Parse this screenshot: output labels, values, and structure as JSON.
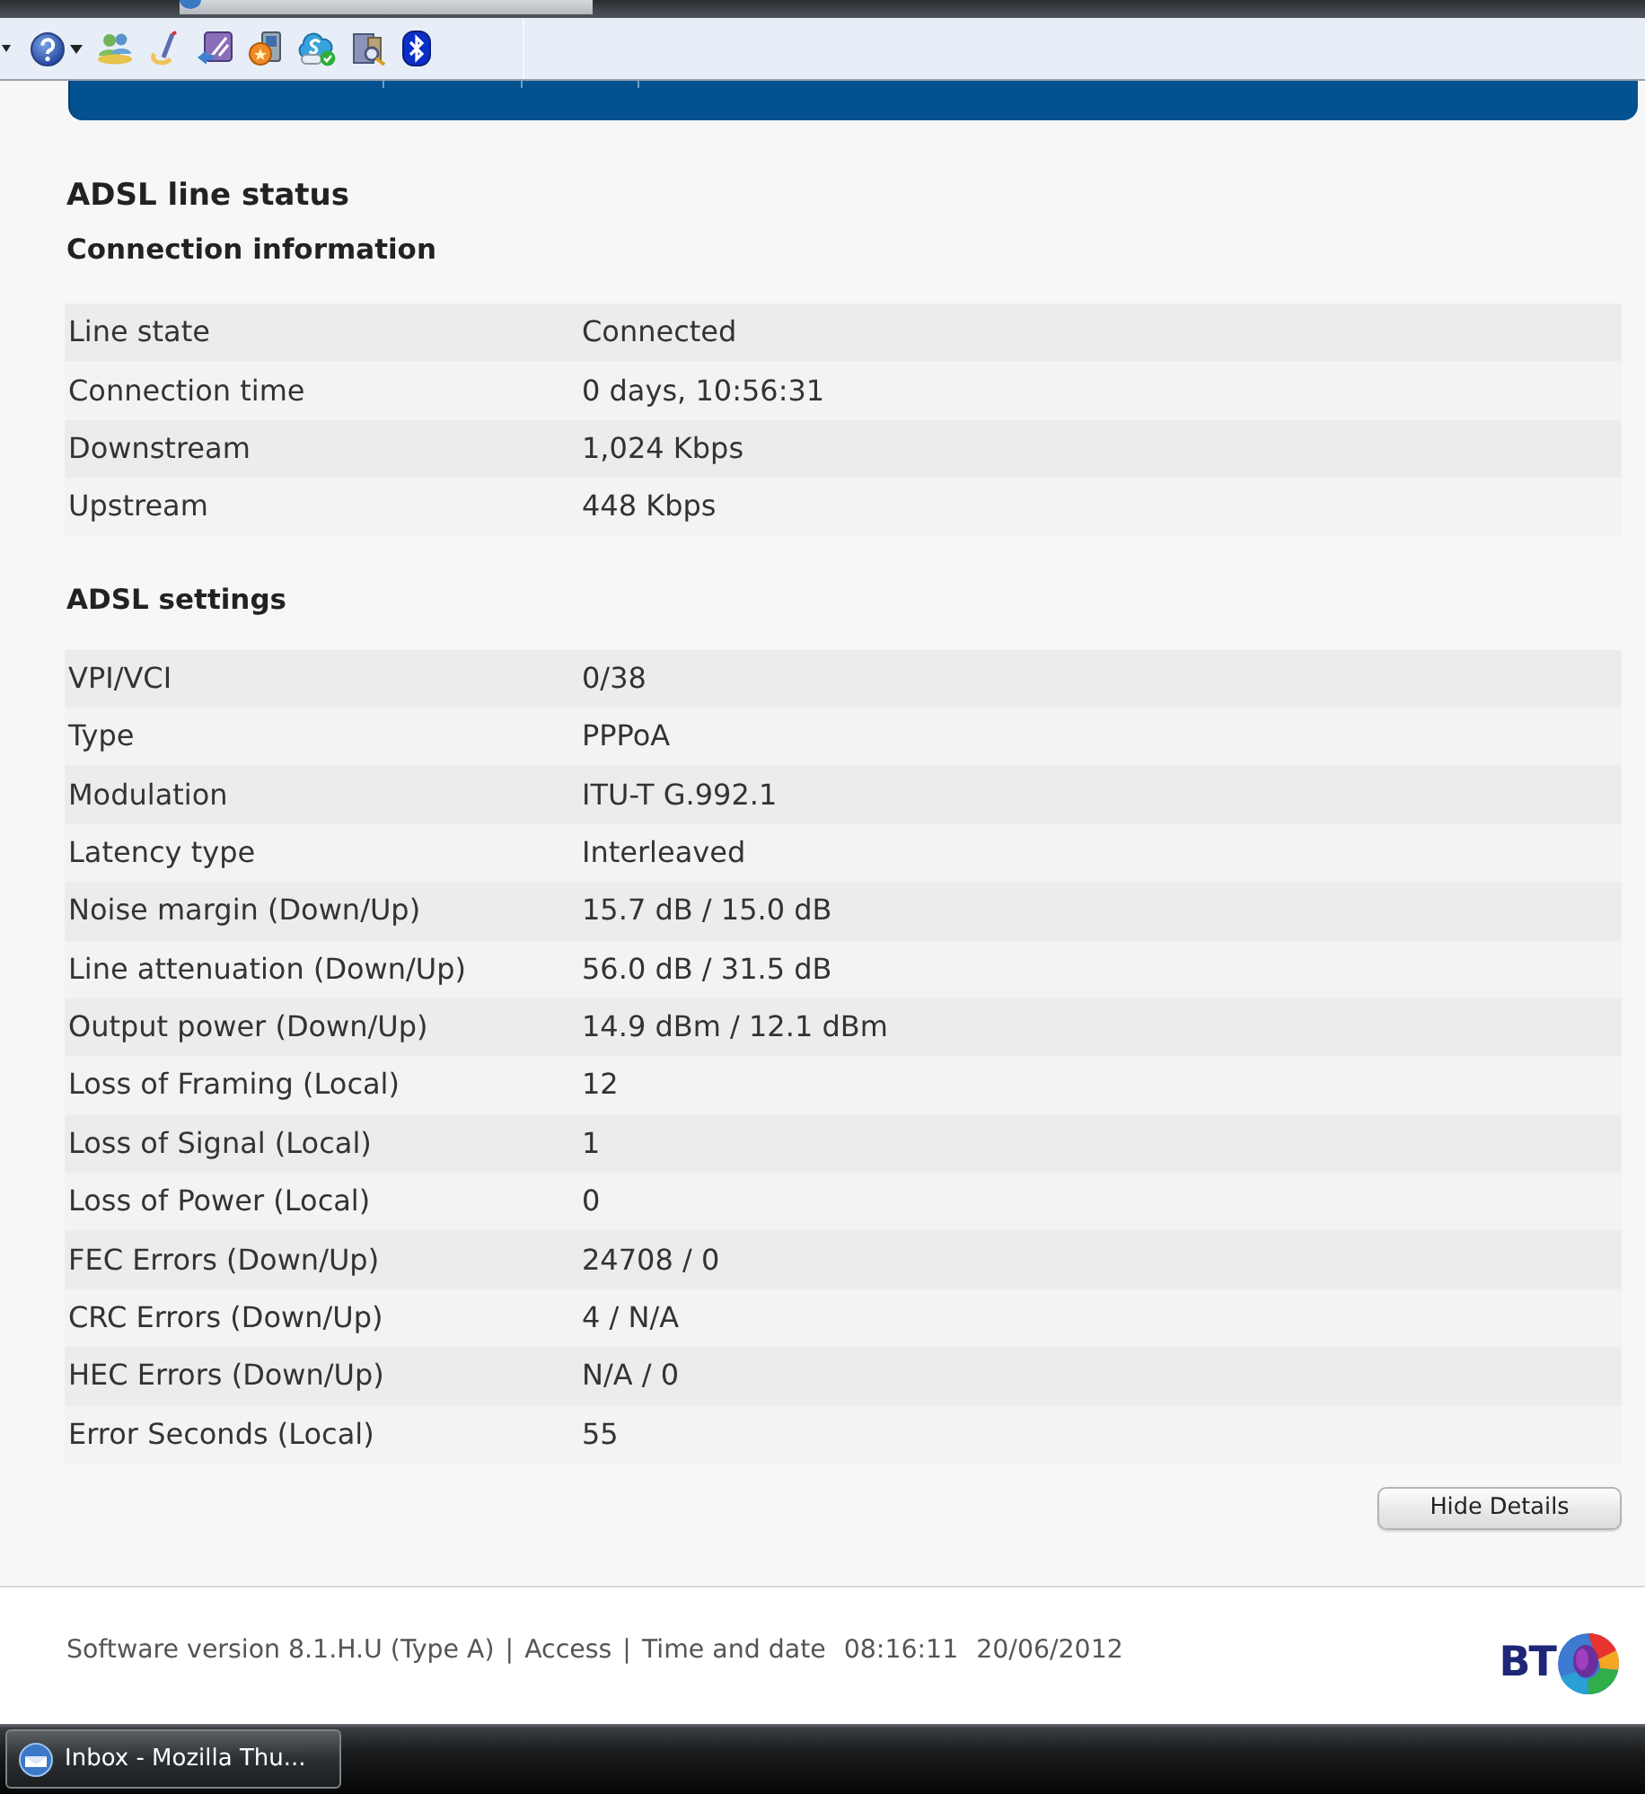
{
  "page": {
    "title": "ADSL line status",
    "sections": [
      {
        "title": "Connection information",
        "rows": [
          {
            "label": "Line state",
            "value": "Connected"
          },
          {
            "label": "Connection time",
            "value": "0 days, 10:56:31"
          },
          {
            "label": "Downstream",
            "value": "1,024 Kbps"
          },
          {
            "label": "Upstream",
            "value": "448 Kbps"
          }
        ]
      },
      {
        "title": "ADSL settings",
        "rows": [
          {
            "label": "VPI/VCI",
            "value": "0/38"
          },
          {
            "label": "Type",
            "value": "PPPoA"
          },
          {
            "label": "Modulation",
            "value": "ITU-T G.992.1"
          },
          {
            "label": "Latency type",
            "value": "Interleaved"
          },
          {
            "label": "Noise margin (Down/Up)",
            "value": "15.7 dB / 15.0 dB"
          },
          {
            "label": "Line attenuation (Down/Up)",
            "value": "56.0 dB / 31.5 dB"
          },
          {
            "label": "Output power (Down/Up)",
            "value": "14.9 dBm / 12.1 dBm"
          },
          {
            "label": "Loss of Framing (Local)",
            "value": "12"
          },
          {
            "label": "Loss of Signal (Local)",
            "value": "1"
          },
          {
            "label": "Loss of Power (Local)",
            "value": "0"
          },
          {
            "label": "FEC Errors (Down/Up)",
            "value": "24708 / 0"
          },
          {
            "label": "CRC Errors (Down/Up)",
            "value": "4 / N/A"
          },
          {
            "label": "HEC Errors (Down/Up)",
            "value": "N/A / 0"
          },
          {
            "label": "Error Seconds (Local)",
            "value": "55"
          }
        ]
      }
    ],
    "button": {
      "label": "Hide Details"
    }
  },
  "footer": {
    "segments": [
      {
        "kind": "version",
        "text": "Software version 8.1.H.U (Type A)"
      },
      {
        "kind": "separator",
        "text": "|"
      },
      {
        "kind": "link",
        "text": "Access"
      },
      {
        "kind": "separator",
        "text": "|"
      },
      {
        "kind": "label",
        "text": "Time and date"
      },
      {
        "kind": "time",
        "text": "08:16:11"
      },
      {
        "kind": "date",
        "text": "20/06/2012"
      }
    ],
    "logo": {
      "text": "BT"
    }
  },
  "taskbar": {
    "buttons": [
      {
        "label": "Inbox - Mozilla Thu..."
      }
    ]
  }
}
